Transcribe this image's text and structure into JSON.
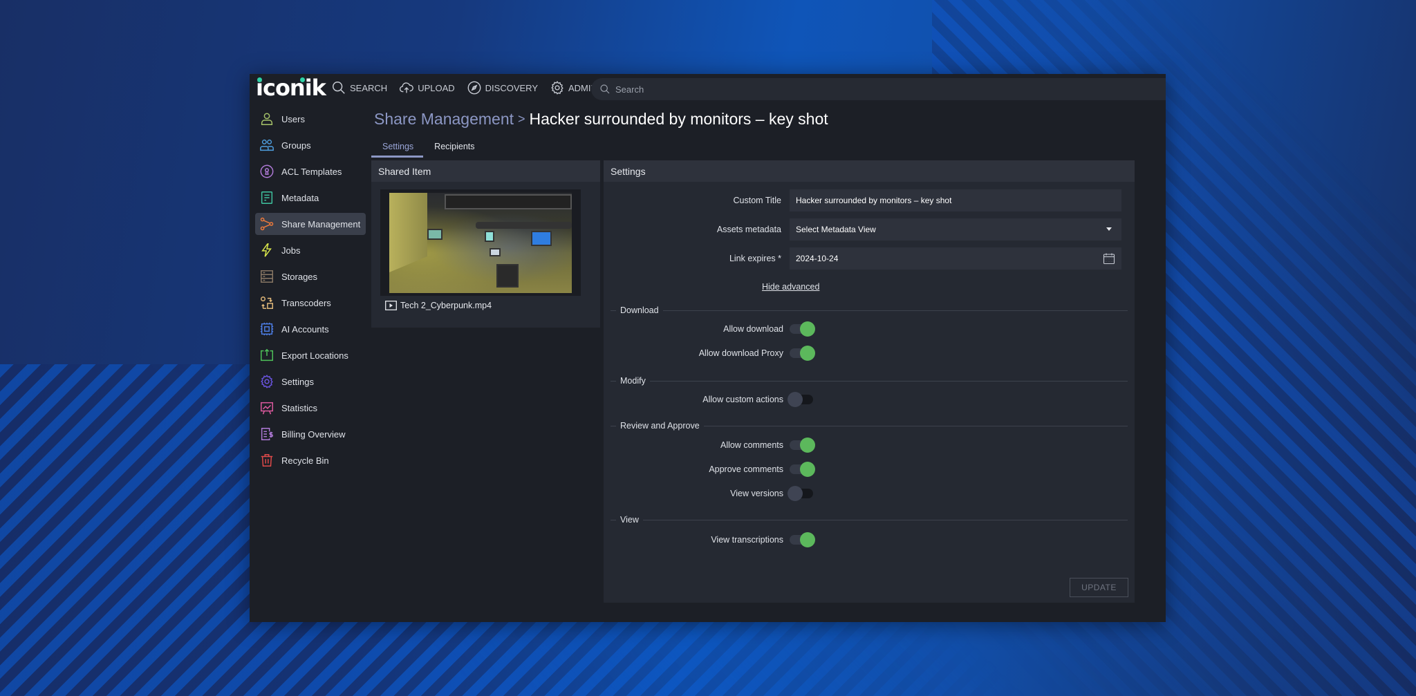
{
  "app": {
    "logo_text": "iconik",
    "brand_dot_color": "#2ed3a7"
  },
  "topnav": {
    "items": [
      {
        "label": "SEARCH",
        "icon": "search-icon"
      },
      {
        "label": "UPLOAD",
        "icon": "cloud-upload-icon"
      },
      {
        "label": "DISCOVERY",
        "icon": "compass-icon"
      },
      {
        "label": "ADMIN",
        "icon": "gear-icon"
      }
    ],
    "search_placeholder": "Search"
  },
  "sidebar": {
    "items": [
      {
        "label": "Users",
        "icon": "user-icon",
        "color": "#a7c46a"
      },
      {
        "label": "Groups",
        "icon": "group-icon",
        "color": "#4f9fe0"
      },
      {
        "label": "ACL Templates",
        "icon": "keyhole-icon",
        "color": "#b07ad8"
      },
      {
        "label": "Metadata",
        "icon": "document-icon",
        "color": "#3fc4a0"
      },
      {
        "label": "Share Management",
        "icon": "share-icon",
        "color": "#ee7a3b",
        "active": true
      },
      {
        "label": "Jobs",
        "icon": "lightning-icon",
        "color": "#d9e64a"
      },
      {
        "label": "Storages",
        "icon": "storage-icon",
        "color": "#8a7865"
      },
      {
        "label": "Transcoders",
        "icon": "transcode-icon",
        "color": "#e2b97a"
      },
      {
        "label": "AI Accounts",
        "icon": "chip-icon",
        "color": "#4d7ee6"
      },
      {
        "label": "Export Locations",
        "icon": "export-icon",
        "color": "#4fc25a"
      },
      {
        "label": "Settings",
        "icon": "gear-icon",
        "color": "#6a54e0"
      },
      {
        "label": "Statistics",
        "icon": "chart-board-icon",
        "color": "#e05aa0"
      },
      {
        "label": "Billing Overview",
        "icon": "billing-icon",
        "color": "#b07ad8"
      },
      {
        "label": "Recycle Bin",
        "icon": "trash-icon",
        "color": "#e24a4a"
      }
    ]
  },
  "breadcrumb": {
    "parent": "Share Management",
    "separator": ">",
    "current": "Hacker surrounded by monitors – key shot"
  },
  "tabs": [
    {
      "label": "Settings",
      "active": true
    },
    {
      "label": "Recipients",
      "active": false
    }
  ],
  "shared_item": {
    "header": "Shared Item",
    "file_name": "Tech 2_Cyberpunk.mp4",
    "file_icon": "video-file-icon"
  },
  "settings": {
    "header": "Settings",
    "fields": {
      "custom_title": {
        "label": "Custom Title",
        "value": "Hacker surrounded by monitors – key shot"
      },
      "assets_metadata": {
        "label": "Assets metadata",
        "value": "Select Metadata View"
      },
      "link_expires": {
        "label": "Link expires *",
        "value": "2024-10-24"
      }
    },
    "hide_advanced": "Hide advanced",
    "sections": [
      {
        "title": "Download",
        "toggles": [
          {
            "label": "Allow download",
            "on": true
          },
          {
            "label": "Allow download Proxy",
            "on": true
          }
        ]
      },
      {
        "title": "Modify",
        "toggles": [
          {
            "label": "Allow custom actions",
            "on": false
          }
        ]
      },
      {
        "title": "Review and Approve",
        "toggles": [
          {
            "label": "Allow comments",
            "on": true
          },
          {
            "label": "Approve comments",
            "on": true
          },
          {
            "label": "View versions",
            "on": false
          }
        ]
      },
      {
        "title": "View",
        "toggles": [
          {
            "label": "View transcriptions",
            "on": true
          }
        ]
      }
    ],
    "update_label": "UPDATE",
    "toggle_on_color": "#5cb85c"
  }
}
